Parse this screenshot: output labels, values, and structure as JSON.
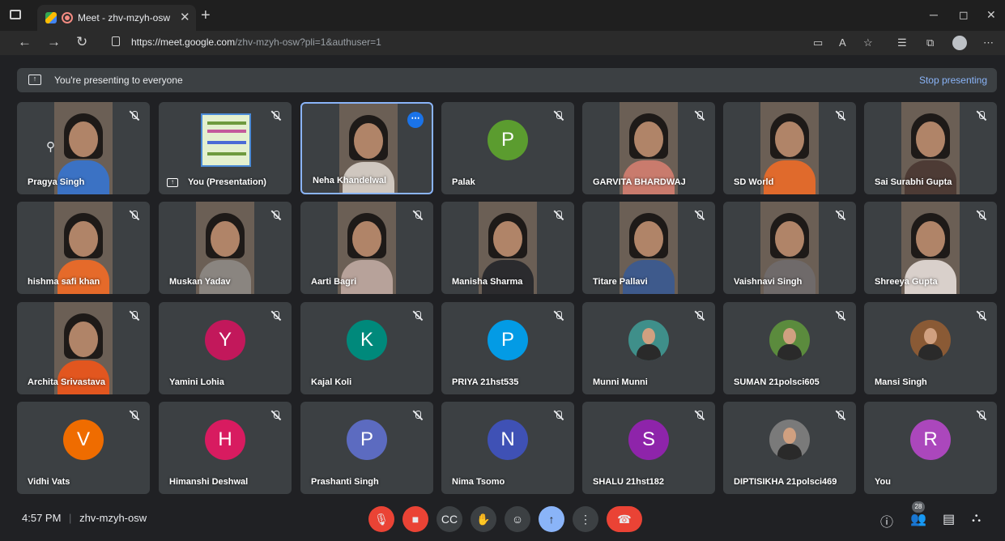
{
  "browser": {
    "tab_title": "Meet - zhv-mzyh-osw",
    "url_host": "https://meet.google.com",
    "url_path": "/zhv-mzyh-osw?pli=1&authuser=1"
  },
  "present_bar": {
    "text": "You're presenting to everyone",
    "stop": "Stop presenting"
  },
  "tiles": [
    {
      "name": "Pragya Singh",
      "kind": "video",
      "pinned_controls": true,
      "shirt": "#3b72c4"
    },
    {
      "name": "You (Presentation)",
      "kind": "presentation"
    },
    {
      "name": "Neha Khandelwal",
      "kind": "video",
      "active": true,
      "shirt": "#cfc7bf"
    },
    {
      "name": "Palak",
      "kind": "letter",
      "letter": "P",
      "color": "#5b9c2f"
    },
    {
      "name": "GARVITA BHARDWAJ",
      "kind": "video",
      "shirt": "#c97b6d"
    },
    {
      "name": "SD World",
      "kind": "video",
      "shirt": "#e06a2c"
    },
    {
      "name": "Sai Surabhi Gupta",
      "kind": "video",
      "shirt": "#4d3b35"
    },
    {
      "name": "hishma safi khan",
      "kind": "video",
      "shirt": "#e56a2a"
    },
    {
      "name": "Muskan Yadav",
      "kind": "video",
      "shirt": "#8a8580"
    },
    {
      "name": "Aarti Bagri",
      "kind": "video",
      "shirt": "#b7a29a"
    },
    {
      "name": "Manisha Sharma",
      "kind": "video",
      "shirt": "#2b2b2e"
    },
    {
      "name": "Titare Pallavi",
      "kind": "video",
      "shirt": "#3e5a8c"
    },
    {
      "name": "Vaishnavi Singh",
      "kind": "video",
      "shirt": "#6f6a6a"
    },
    {
      "name": "Shreeya Gupta",
      "kind": "video",
      "shirt": "#d9d0cb"
    },
    {
      "name": "Archita Srivastava",
      "kind": "video",
      "shirt": "#e2561f"
    },
    {
      "name": "Yamini Lohia",
      "kind": "letter",
      "letter": "Y",
      "color": "#c2185b"
    },
    {
      "name": "Kajal Koli",
      "kind": "letter",
      "letter": "K",
      "color": "#00897b"
    },
    {
      "name": "PRIYA 21hst535",
      "kind": "letter",
      "letter": "P",
      "color": "#039be5"
    },
    {
      "name": "Munni Munni",
      "kind": "photo",
      "color": "#3f8f8a"
    },
    {
      "name": "SUMAN 21polsci605",
      "kind": "photo",
      "color": "#5b8b3d"
    },
    {
      "name": "Mansi Singh",
      "kind": "photo",
      "color": "#8a5a35"
    },
    {
      "name": "Vidhi Vats",
      "kind": "letter",
      "letter": "V",
      "color": "#ef6c00"
    },
    {
      "name": "Himanshi Deshwal",
      "kind": "letter",
      "letter": "H",
      "color": "#d81b60"
    },
    {
      "name": "Prashanti Singh",
      "kind": "letter",
      "letter": "P",
      "color": "#5c6bc0"
    },
    {
      "name": "Nima Tsomo",
      "kind": "letter",
      "letter": "N",
      "color": "#3f51b5"
    },
    {
      "name": "SHALU 21hst182",
      "kind": "letter",
      "letter": "S",
      "color": "#8e24aa"
    },
    {
      "name": "DIPTISIKHA 21polsci469",
      "kind": "photo",
      "color": "#7a7a7a"
    },
    {
      "name": "You",
      "kind": "letter",
      "letter": "R",
      "color": "#ab47bc"
    }
  ],
  "footer": {
    "time": "4:57 PM",
    "meeting_code": "zhv-mzyh-osw",
    "participants_count": "28"
  }
}
